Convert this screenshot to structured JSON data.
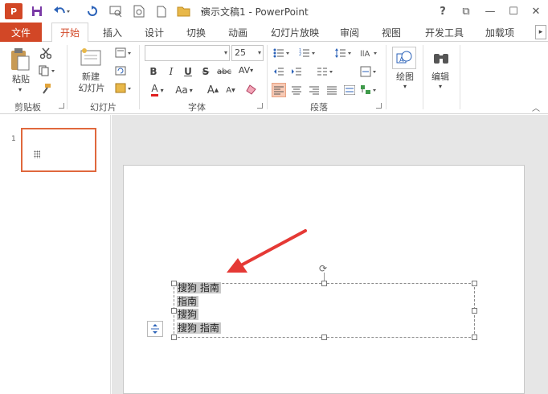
{
  "window": {
    "title": "演示文稿1 - PowerPoint",
    "app_icon_text": "P",
    "controls": {
      "help": "?",
      "restore_ribbon": "⧉",
      "minimize": "—",
      "maximize": "☐",
      "close": "✕"
    }
  },
  "quick_access": {
    "icons": [
      "save-icon",
      "undo-icon",
      "redo-icon",
      "present-icon",
      "print-preview-icon",
      "new-icon",
      "open-icon",
      "customize-icon"
    ]
  },
  "tabs": [
    {
      "label": "文件"
    },
    {
      "label": "开始",
      "active": true
    },
    {
      "label": "插入"
    },
    {
      "label": "设计"
    },
    {
      "label": "切换"
    },
    {
      "label": "动画"
    },
    {
      "label": "幻灯片放映"
    },
    {
      "label": "审阅"
    },
    {
      "label": "视图"
    },
    {
      "label": "开发工具"
    },
    {
      "label": "加载项"
    }
  ],
  "ribbon": {
    "clipboard": {
      "label": "剪贴板",
      "paste_label": "粘贴"
    },
    "slides": {
      "label": "幻灯片",
      "new_slide_label_1": "新建",
      "new_slide_label_2": "幻灯片"
    },
    "font": {
      "label": "字体",
      "font_name": "",
      "font_size": "25",
      "bold": "B",
      "italic": "I",
      "underline": "U",
      "strike": "S",
      "shadow": "abc",
      "spacing": "AV",
      "font_color": "A",
      "change_case": "Aa",
      "grow": "A",
      "shrink": "A"
    },
    "paragraph": {
      "label": "段落"
    },
    "drawing": {
      "label": "绘图"
    },
    "editing": {
      "label": "编辑"
    }
  },
  "thumbnails": [
    {
      "number": "1"
    }
  ],
  "textbox": {
    "lines": [
      "搜狗 指南",
      "指南",
      "搜狗",
      "搜狗 指南"
    ]
  },
  "colors": {
    "accent": "#d24726",
    "annotation_arrow": "#e53935",
    "selection_border": "#e0683d",
    "text_highlight": "#c9c9c9"
  }
}
